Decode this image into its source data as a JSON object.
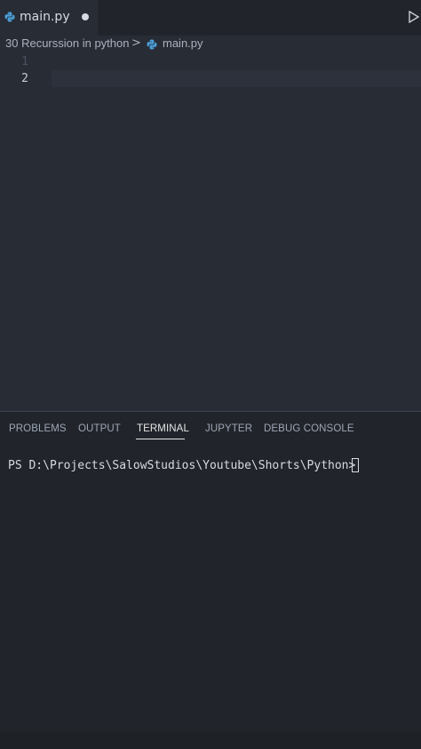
{
  "tab": {
    "filename": "main.py",
    "unsaved": true
  },
  "breadcrumb": {
    "folder": "30 Recurssion in python",
    "separator": ">",
    "file": "main.py"
  },
  "editor": {
    "line_numbers": [
      "1",
      "2"
    ],
    "active_line": 2
  },
  "panel": {
    "tabs": [
      "PROBLEMS",
      "OUTPUT",
      "TERMINAL",
      "JUPYTER",
      "DEBUG CONSOLE"
    ],
    "active_tab": "TERMINAL",
    "terminal_prompt": "PS D:\\Projects\\SalowStudios\\Youtube\\Shorts\\Python> "
  },
  "icons": {
    "tab_icon": "python-icon",
    "breadcrumb_icon": "python-icon",
    "run": "run-icon"
  },
  "colors": {
    "editor_bg": "#282c34",
    "panel_bg": "#21252b",
    "python_icon": "#4a9fd8"
  }
}
